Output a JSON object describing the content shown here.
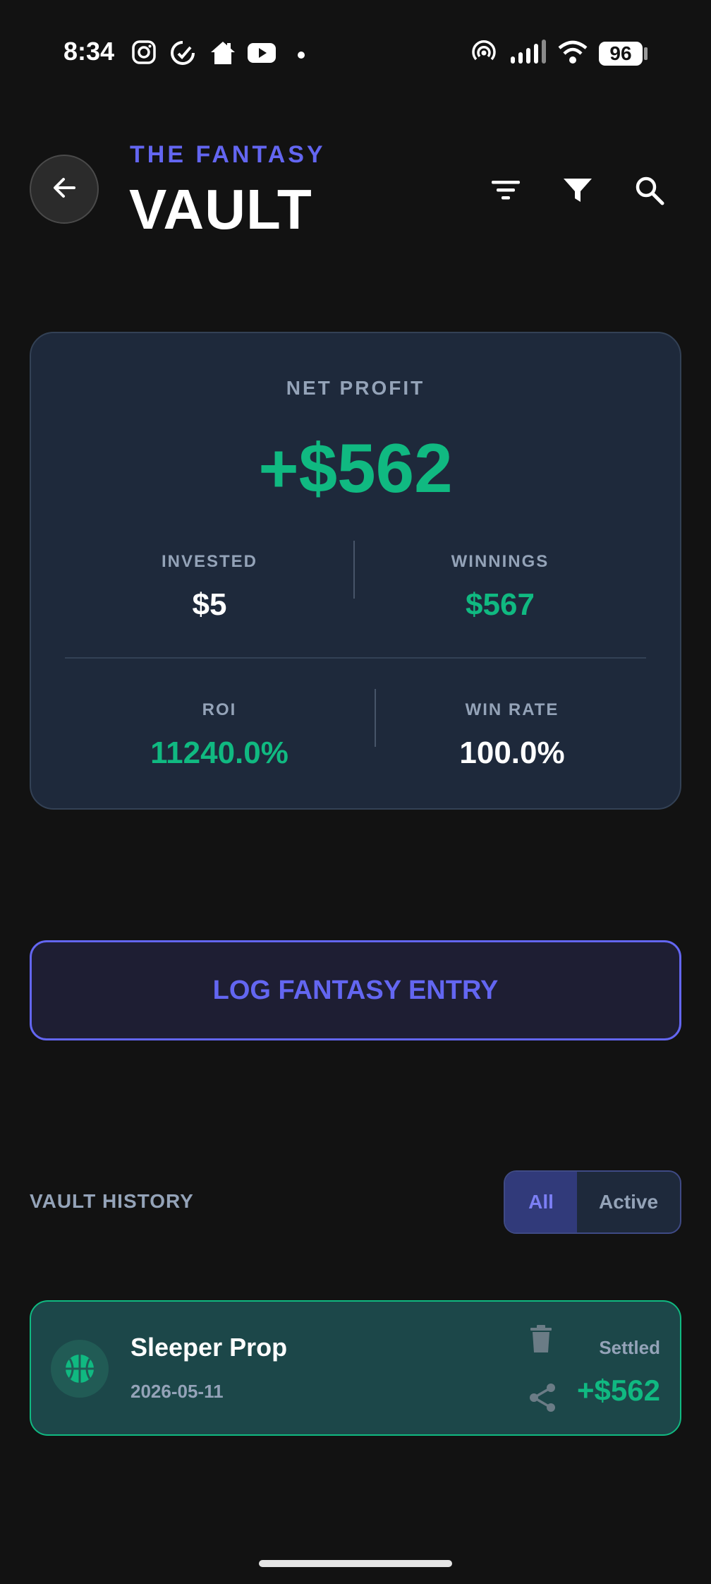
{
  "status_bar": {
    "time": "8:34",
    "battery": "96",
    "icons": [
      "instagram-icon",
      "sync-icon",
      "home-icon",
      "youtube-icon",
      "dot-icon",
      "hotspot-icon",
      "signal-icon",
      "wifi-icon",
      "battery-icon"
    ]
  },
  "header": {
    "brand_top": "THE FANTASY",
    "brand_title": "VAULT",
    "icons": [
      "back-arrow-icon",
      "sort-icon",
      "filter-icon",
      "search-icon"
    ]
  },
  "summary": {
    "net_profit_label": "NET PROFIT",
    "net_profit_value": "+$562",
    "invested_label": "INVESTED",
    "invested_value": "$5",
    "winnings_label": "WINNINGS",
    "winnings_value": "$567",
    "roi_label": "ROI",
    "roi_value": "11240.0%",
    "win_rate_label": "WIN RATE",
    "win_rate_value": "100.0%"
  },
  "actions": {
    "log_entry_label": "LOG FANTASY ENTRY"
  },
  "history": {
    "title": "VAULT HISTORY",
    "filter_all": "All",
    "filter_active": "Active",
    "entries": [
      {
        "title": "Sleeper Prop",
        "date": "2026-05-11",
        "status": "Settled",
        "amount": "+$562",
        "icon": "basketball-icon"
      }
    ]
  },
  "colors": {
    "accent": "#6366f1",
    "profit": "#10b981",
    "card": "#1e293b",
    "background": "#121212"
  }
}
